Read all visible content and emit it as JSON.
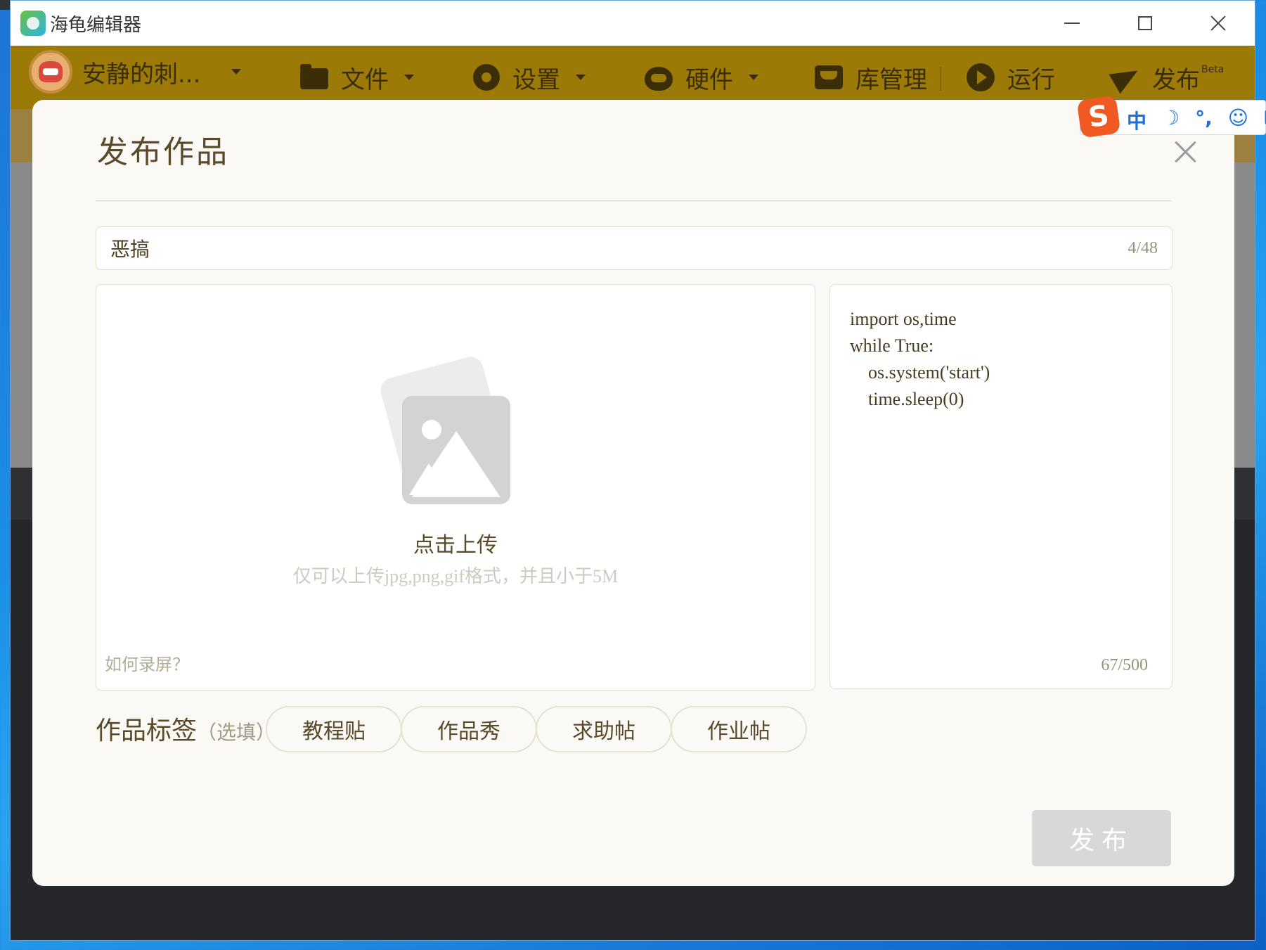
{
  "window": {
    "title": "海龟编辑器",
    "controls": [
      "minimize",
      "maximize",
      "close"
    ]
  },
  "toolbar": {
    "user_name": "安静的刺...",
    "items": [
      {
        "label": "文件",
        "icon": "folder-icon",
        "dropdown": true
      },
      {
        "label": "设置",
        "icon": "gear-icon",
        "dropdown": true
      },
      {
        "label": "硬件",
        "icon": "robot-icon",
        "dropdown": true
      },
      {
        "label": "库管理",
        "icon": "box-icon",
        "dropdown": false
      },
      {
        "label": "运行",
        "icon": "play-icon",
        "dropdown": false
      },
      {
        "label": "发布",
        "icon": "paper-plane-icon",
        "dropdown": false,
        "badge": "Beta"
      }
    ],
    "color": "#9c7a08"
  },
  "ime": {
    "logo": "S",
    "items": [
      "中",
      "☽",
      "°,",
      "☺",
      "⌨"
    ]
  },
  "modal": {
    "title": "发布作品",
    "work_title": {
      "value": "恶搞",
      "count": "4/48"
    },
    "upload": {
      "label": "点击上传",
      "hint": "仅可以上传jpg,png,gif格式，并且小于5M",
      "record_link": "如何录屏？"
    },
    "code": {
      "lines": [
        "import os,time",
        "while True:",
        "    os.system('start')",
        "    time.sleep(0)"
      ],
      "count": "67/500"
    },
    "tags": {
      "label": "作品标签",
      "optional": "（选填）",
      "options": [
        "教程贴",
        "作品秀",
        "求助帖",
        "作业帖"
      ]
    },
    "submit_label": "发布"
  }
}
